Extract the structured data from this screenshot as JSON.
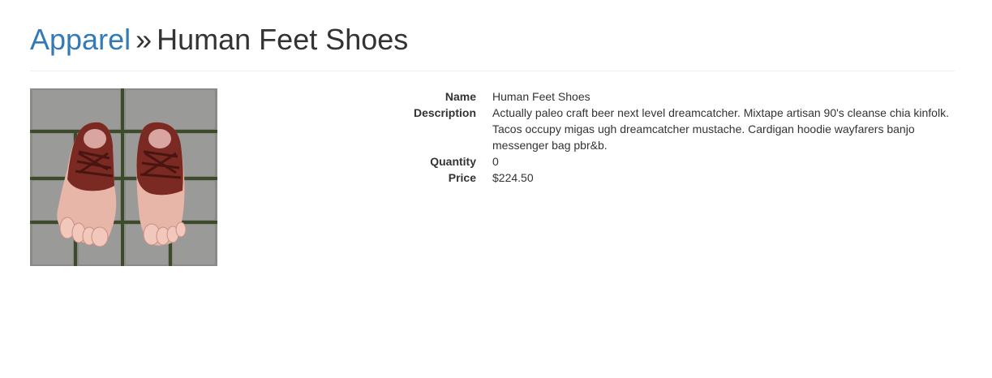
{
  "breadcrumb": {
    "category": "Apparel",
    "separator": "»",
    "product": "Human Feet Shoes"
  },
  "product": {
    "image_icon": "shoes-photo",
    "fields": [
      {
        "label": "Name",
        "value": "Human Feet Shoes"
      },
      {
        "label": "Description",
        "value": "Actually paleo craft beer next level dreamcatcher. Mixtape artisan 90's cleanse chia kinfolk. Tacos occupy migas ugh dreamcatcher mustache. Cardigan hoodie wayfarers banjo messenger bag pbr&b."
      },
      {
        "label": "Quantity",
        "value": "0"
      },
      {
        "label": "Price",
        "value": "$224.50"
      }
    ]
  },
  "colors": {
    "link": "#337ab7",
    "text": "#333333",
    "divider": "#eeeeee"
  }
}
